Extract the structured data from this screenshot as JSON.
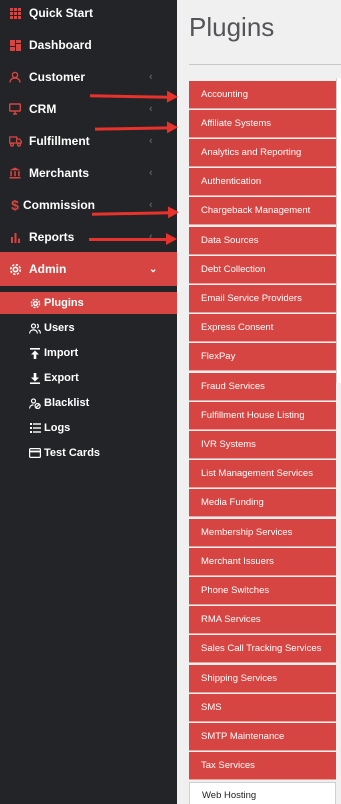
{
  "sidebar": {
    "items": [
      {
        "label": "Quick Start",
        "icon": "grid-icon",
        "chevron": false
      },
      {
        "label": "Dashboard",
        "icon": "dashboard-icon",
        "chevron": false
      },
      {
        "label": "Customer",
        "icon": "customer-icon",
        "chevron": true
      },
      {
        "label": "CRM",
        "icon": "monitor-icon",
        "chevron": true
      },
      {
        "label": "Fulfillment",
        "icon": "truck-icon",
        "chevron": true
      },
      {
        "label": "Merchants",
        "icon": "bank-icon",
        "chevron": true
      },
      {
        "label": "Commission",
        "icon": "dollar-icon",
        "chevron": true
      },
      {
        "label": "Reports",
        "icon": "bar-chart-icon",
        "chevron": true
      },
      {
        "label": "Admin",
        "icon": "gear-icon",
        "chevron": true
      }
    ],
    "admin_sub": [
      {
        "label": "Plugins",
        "icon": "gear-icon"
      },
      {
        "label": "Users",
        "icon": "users-icon"
      },
      {
        "label": "Import",
        "icon": "import-icon"
      },
      {
        "label": "Export",
        "icon": "export-icon"
      },
      {
        "label": "Blacklist",
        "icon": "blacklist-icon"
      },
      {
        "label": "Logs",
        "icon": "list-icon"
      },
      {
        "label": "Test Cards",
        "icon": "credit-card-icon"
      }
    ]
  },
  "main": {
    "title": "Plugins",
    "plugins": [
      "Accounting",
      "Affiliate Systems",
      "Analytics and Reporting",
      "Authentication",
      "Chargeback Management",
      "Data Sources",
      "Debt Collection",
      "Email Service Providers",
      "Express Consent",
      "FlexPay",
      "Fraud Services",
      "Fulfillment House Listing",
      "IVR Systems",
      "List Management Services",
      "Media Funding",
      "Membership Services",
      "Merchant Issuers",
      "Phone Switches",
      "RMA Services",
      "Sales Call Tracking Services",
      "Shipping Services",
      "SMS",
      "SMTP Maintenance",
      "Tax Services",
      "Web Hosting"
    ]
  },
  "colors": {
    "sidebar_bg": "#232427",
    "accent": "#d64541",
    "arrow": "#e8322b",
    "page_bg": "#f0f0f0"
  }
}
